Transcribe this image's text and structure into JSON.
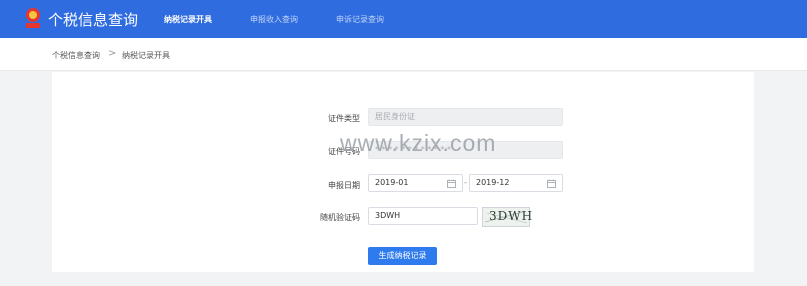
{
  "header": {
    "brand": "个税信息查询",
    "nav": [
      {
        "label": "纳税记录开具",
        "active": true
      },
      {
        "label": "申报收入查询",
        "active": false
      },
      {
        "label": "申诉记录查询",
        "active": false
      }
    ],
    "bg_color": "#2f6ce0"
  },
  "breadcrumb": {
    "items": [
      "个税信息查询",
      "纳税记录开具"
    ],
    "separator": ">"
  },
  "form": {
    "id_type": {
      "label": "证件类型",
      "value": "居民身份证"
    },
    "id_number": {
      "label": "证件号码",
      "value": "* * * * * * * * * * * *"
    },
    "period": {
      "label": "申报日期",
      "start": "2019-01",
      "end": "2019-12",
      "separator": "-"
    },
    "captcha": {
      "label": "随机验证码",
      "value": "3DWH",
      "image_text": "3DWH"
    },
    "submit_label": "生成纳税记录"
  },
  "watermark": "www.kzix.com"
}
